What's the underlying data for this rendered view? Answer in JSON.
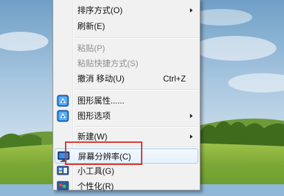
{
  "context_menu": {
    "items": {
      "sort": {
        "label": "排序方式(O)"
      },
      "refresh": {
        "label": "刷新(E)"
      },
      "paste": {
        "label": "粘贴(P)"
      },
      "paste_shortcut": {
        "label": "粘贴快捷方式(S)"
      },
      "undo_move": {
        "label": "撤消 移动(U)",
        "shortcut": "Ctrl+Z"
      },
      "graphics_properties": {
        "label": "图形属性......",
        "icon": "graphics-icon"
      },
      "graphics_options": {
        "label": "图形选项",
        "icon": "graphics-icon"
      },
      "new": {
        "label": "新建(W)"
      },
      "screen_resolution": {
        "label": "屏幕分辨率(C)",
        "icon": "monitor-icon"
      },
      "gadgets": {
        "label": "小工具(G)",
        "icon": "gadgets-icon"
      },
      "personalize": {
        "label": "个性化(R)",
        "icon": "personalize-icon"
      }
    }
  },
  "colors": {
    "menu_background": "#f1f1f1",
    "disabled_text": "#8d8d8d",
    "highlight_border": "#d9342b",
    "hover_border": "#a8cdef"
  }
}
